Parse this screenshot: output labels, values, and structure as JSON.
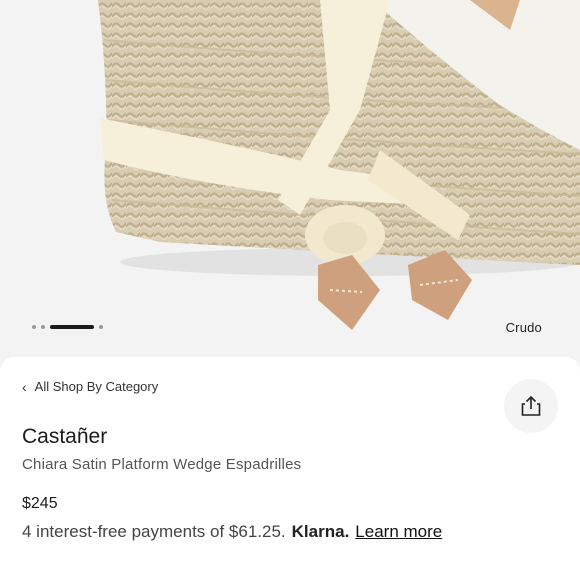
{
  "carousel": {
    "dots": [
      {
        "active": false
      },
      {
        "active": false
      },
      {
        "active": true
      },
      {
        "active": false
      }
    ],
    "color_label": "Crudo"
  },
  "nav": {
    "back_label": "All Shop By Category"
  },
  "product": {
    "brand": "Castañer",
    "name": "Chiara Satin Platform Wedge Espadrilles",
    "price": "$245",
    "installments": {
      "text": "4 interest-free payments of $61.25.",
      "provider": "Klarna.",
      "link_label": "Learn more"
    }
  },
  "icons": {
    "back": "chevron-left-icon",
    "share": "share-icon"
  }
}
